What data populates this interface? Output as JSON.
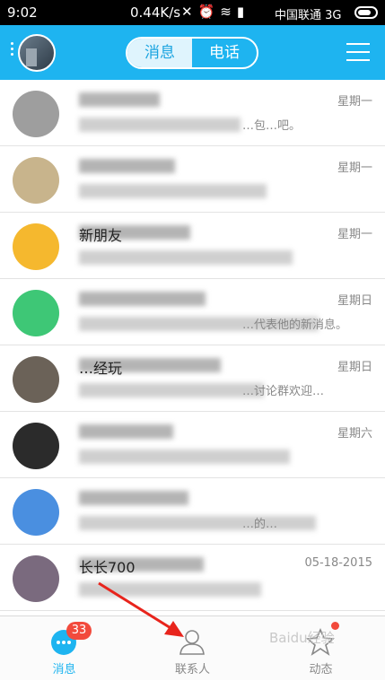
{
  "status_bar": {
    "time": "9:02",
    "speed": "0.44K/s",
    "carrier": "中国联通 3G"
  },
  "header": {
    "tabs": [
      {
        "label": "消息",
        "active": true
      },
      {
        "label": "电话",
        "active": false
      }
    ]
  },
  "conversations": [
    {
      "name": "",
      "preview": "…包…吧。",
      "time": "星期一",
      "avatar_color": "#9e9e9e"
    },
    {
      "name": "",
      "preview": "",
      "time": "星期一",
      "avatar_color": "#c8b48c"
    },
    {
      "name": "新朋友",
      "preview": "",
      "time": "星期一",
      "avatar_color": "#f5b82e"
    },
    {
      "name": "",
      "preview": "…代表他的新消息。",
      "time": "星期日",
      "avatar_color": "#3ec776"
    },
    {
      "name": "…经玩",
      "preview": "…讨论群欢迎…",
      "time": "星期日",
      "avatar_color": "#6b6258"
    },
    {
      "name": "",
      "preview": "",
      "time": "星期六",
      "avatar_color": "#2b2b2b"
    },
    {
      "name": "",
      "preview": "…的…",
      "time": "",
      "avatar_color": "#4a8fe0"
    },
    {
      "name": "长长700",
      "preview": "",
      "time": "05-18-2015",
      "avatar_color": "#7a6a7e"
    }
  ],
  "tab_bar": {
    "messages_label": "消息",
    "messages_badge": "33",
    "contacts_label": "联系人",
    "activity_label": "动态"
  },
  "colors": {
    "accent": "#1eb4f0",
    "badge": "#f24a3c",
    "annotation_arrow": "#e8241c"
  },
  "watermark": "Baidu经验"
}
